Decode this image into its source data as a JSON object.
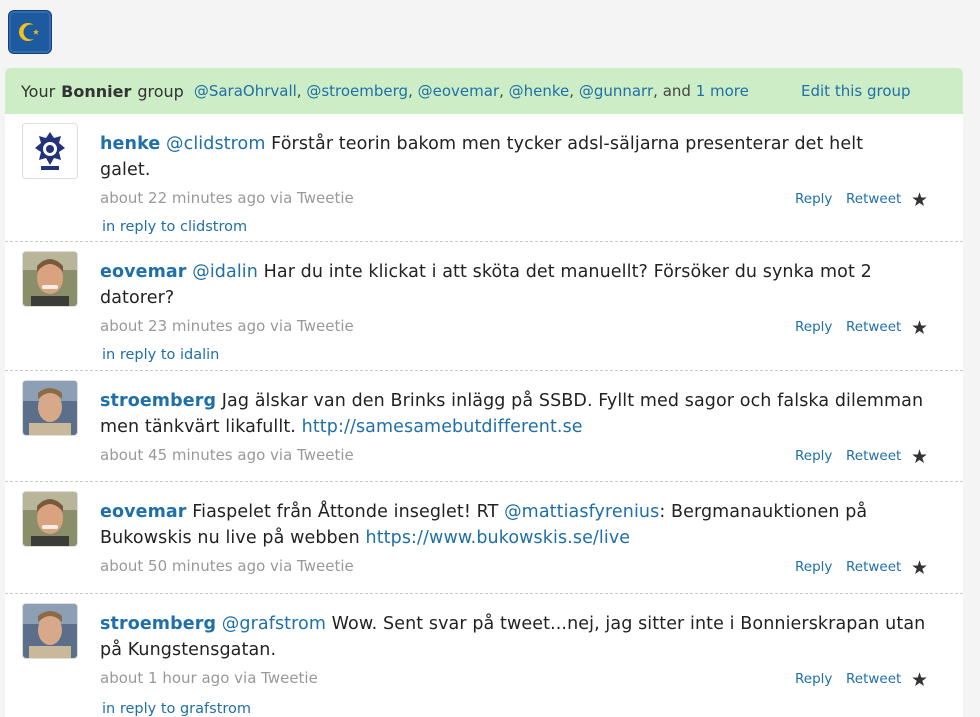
{
  "group": {
    "prefix": "Your",
    "name": "Bonnier",
    "suffix": "group",
    "members": [
      "@SaraOhrvall",
      "@stroemberg",
      "@eovemar",
      "@henke",
      "@gunnarr"
    ],
    "and_text": "and",
    "more_text": "1 more",
    "edit_label": "Edit this group"
  },
  "actions": {
    "reply": "Reply",
    "retweet": "Retweet"
  },
  "tweets": [
    {
      "user": "henke",
      "mention": "@clidstrom",
      "text_line1": "Förstår teorin bakom men tycker adsl-säljarna presenterar det helt",
      "text_line2": "galet.",
      "meta": "about 22 minutes ago via Tweetie",
      "reply_to": "in reply to clidstrom"
    },
    {
      "user": "eovemar",
      "mention": "@idalin",
      "text_line1": "Har du inte klickat i att sköta det manuellt? Försöker du synka mot 2",
      "text_line2": "datorer?",
      "meta": "about 23 minutes ago via Tweetie",
      "reply_to": "in reply to idalin"
    },
    {
      "user": "stroemberg",
      "text_line1": "Jag älskar van den Brinks inlägg på SSBD. Fyllt med sagor och falska dilemman",
      "text_line2": "men tänkvärt likafullt.",
      "link": "http://samesamebutdifferent.se",
      "meta": "about 45 minutes ago via Tweetie"
    },
    {
      "user": "eovemar",
      "text_line1_a": "Fiaspelet från Åttonde inseglet! RT",
      "mention": "@mattiasfyrenius",
      "text_line1_b": ": Bergmanauktionen på",
      "text_line2": "Bukowskis nu live på webben",
      "link": "https://www.bukowskis.se/live",
      "meta": "about 50 minutes ago via Tweetie"
    },
    {
      "user": "stroemberg",
      "mention": "@grafstrom",
      "text_line1": "Wow. Sent svar på tweet...nej, jag sitter inte i Bonnierskrapan utan",
      "text_line2": "på Kungstensgatan.",
      "meta": "about 1 hour ago via Tweetie",
      "reply_to": "in reply to grafstrom"
    }
  ]
}
